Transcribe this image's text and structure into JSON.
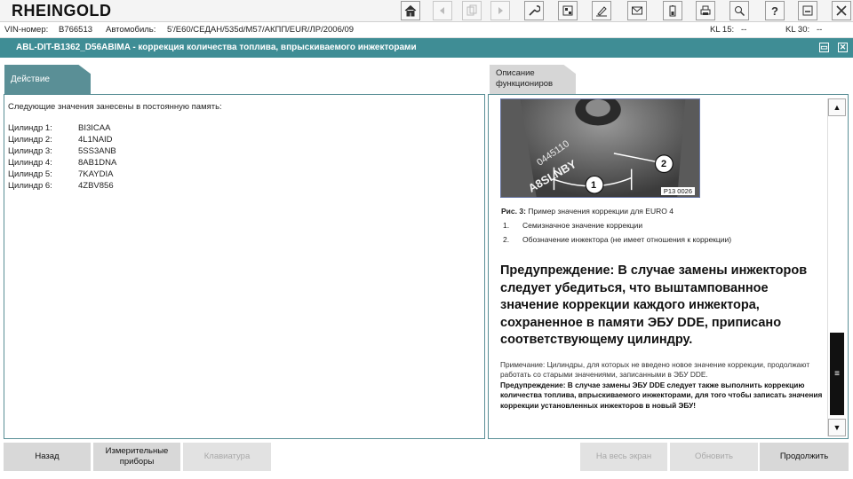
{
  "app": {
    "logo": "RHEINGOLD"
  },
  "toolbar": {
    "icons": [
      "home-icon",
      "back-icon",
      "copy-icon",
      "forward-icon",
      "wrench-icon",
      "tablet-icon",
      "eraser-icon",
      "envelope-icon",
      "battery-icon",
      "printer-icon",
      "search-person-icon",
      "help-icon",
      "minimize-icon",
      "close-icon"
    ]
  },
  "vehicle": {
    "vin_label": "VIN-номер:",
    "vin_value": "B766513",
    "car_label": "Автомобиль:",
    "car_value": "5'/E60/СЕДАН/535d/M57/АКПП/EUR/ЛР/2006/09",
    "kl15_label": "KL 15:",
    "kl15_value": "--",
    "kl30_label": "KL 30:",
    "kl30_value": "--"
  },
  "title": {
    "text": "ABL-DIT-B1362_D56ABIMA  -  коррекция количества топлива, впрыскиваемого инжекторами"
  },
  "left_panel": {
    "tab": "Действие",
    "intro": "Следующие значения занесены в постоянную память:",
    "cylinders": [
      {
        "label": "Цилиндр 1:",
        "value": "BI3ICAA"
      },
      {
        "label": "Цилиндр 2:",
        "value": "4L1NAID"
      },
      {
        "label": "Цилиндр 3:",
        "value": "5SS3ANB"
      },
      {
        "label": "Цилиндр 4:",
        "value": "8AB1DNA"
      },
      {
        "label": "Цилиндр 5:",
        "value": "7KAYDIA"
      },
      {
        "label": "Цилиндр 6:",
        "value": "4ZBV856"
      }
    ]
  },
  "right_panel": {
    "tab": "Описание функциониров",
    "photo_code": "P13 0026",
    "photo_callouts": [
      "1",
      "2"
    ],
    "caption_prefix": "Рис. 3:",
    "caption_text": "Пример значения коррекции для EURO 4",
    "list": [
      {
        "num": "1.",
        "text": "Семизначное значение коррекции"
      },
      {
        "num": "2.",
        "text": "Обозначение инжектора (не имеет отношения к коррекции)"
      }
    ],
    "warning_big": "Предупреждение: В случае замены инжекторов следует убедиться, что выштампованное значение коррекции каждого инжектора, сохраненное в памяти ЭБУ DDE, приписано соответствующему цилиндру.",
    "note": "Примечание: Цилиндры, для которых не введено новое значение коррекции, продолжают работать со старыми значениями, записанными в ЭБУ DDE.",
    "note_warning": "Предупреждение: В случае замены ЭБУ DDE следует также выполнить коррекцию количества топлива, впрыскиваемого инжекторами, для того чтобы записать значения коррекции установленных инжекторов в новый ЭБУ!"
  },
  "buttons": {
    "back": "Назад",
    "measuring": "Измерительные приборы",
    "keyboard": "Клавиатура",
    "fullscreen": "На весь экран",
    "refresh": "Обновить",
    "continue": "Продолжить"
  }
}
